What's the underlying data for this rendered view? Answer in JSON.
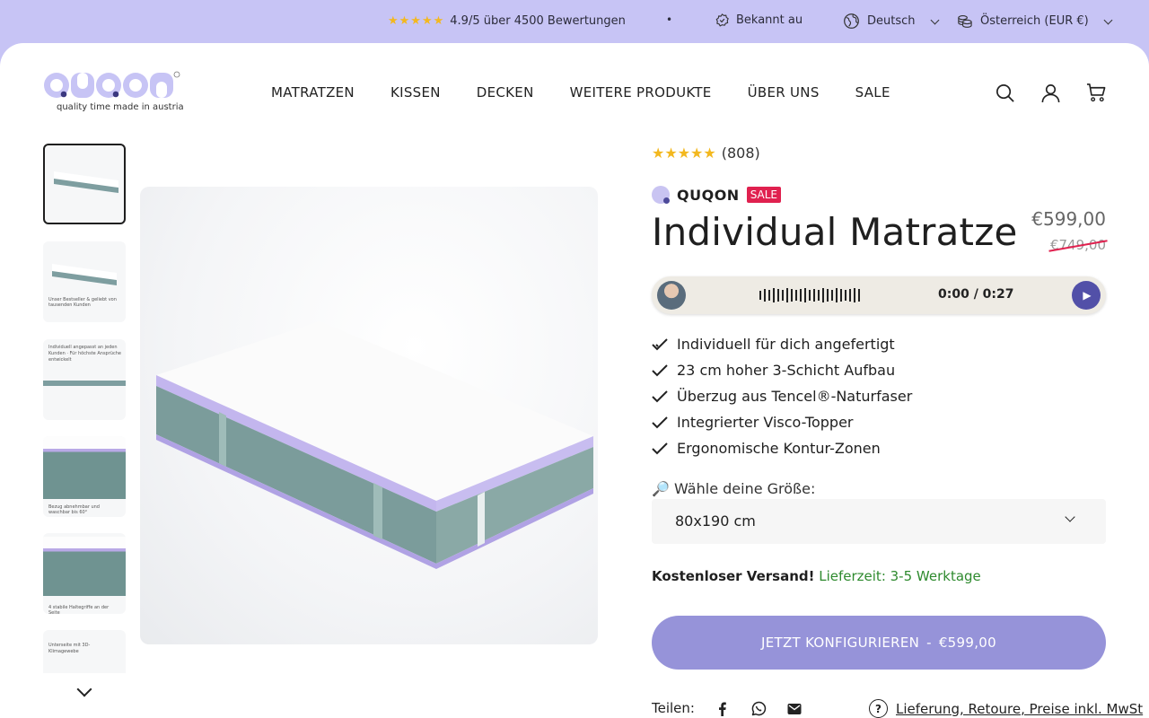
{
  "topbar": {
    "rating_stars": "★★★★★",
    "rating_text": "4.9/5 über 4500 Bewertungen",
    "separator": "•",
    "known_from": "Bekannt au",
    "language": "Deutsch",
    "country": "Österreich (EUR €)"
  },
  "header": {
    "logo_text": "QUQON",
    "logo_tagline": "quality time made in austria",
    "nav": [
      "MATRATZEN",
      "KISSEN",
      "DECKEN",
      "WEITERE PRODUKTE",
      "ÜBER UNS",
      "SALE"
    ]
  },
  "product": {
    "rating_stars": "★★★★★",
    "review_count": "(808)",
    "brand": "QUQON",
    "sale_badge": "SALE",
    "title": "Individual Matratze",
    "price": "€599,00",
    "old_price": "€749,00",
    "audio_time": "0:00 / 0:27",
    "features": [
      "Individuell für dich angefertigt",
      "23 cm hoher 3-Schicht Aufbau",
      "Überzug aus Tencel®-Naturfaser",
      "Integrierter Visco-Topper",
      "Ergonomische Kontur-Zonen"
    ],
    "size_label": "🔎 Wähle deine Größe:",
    "size_value": "80x190 cm",
    "shipping_bold": "Kostenloser Versand!",
    "shipping_time": "Lieferzeit: 3-5 Werktage",
    "cta_label": "JETZT KONFIGURIEREN",
    "cta_separator": "-",
    "cta_price": "€599,00",
    "share_label": "Teilen:",
    "help_link": "Lieferung, Retoure, Preise inkl. MwSt"
  },
  "thumb_texts": [
    "",
    "Unser Bestseller & geliebt von tausenden Kunden",
    "Individuell angepasst an jeden Kunden · Für höchste Ansprüche entwickelt",
    "Bezug abnehmbar und waschbar bis 60°",
    "4 stabile Haltegriffe an der Seite",
    "Unterseite mit 3D-Klimagewebe"
  ],
  "colors": {
    "accent": "#c7c4f5",
    "cta": "#9693d9",
    "sale": "#e0214f",
    "ship_green": "#2e8a2e"
  }
}
